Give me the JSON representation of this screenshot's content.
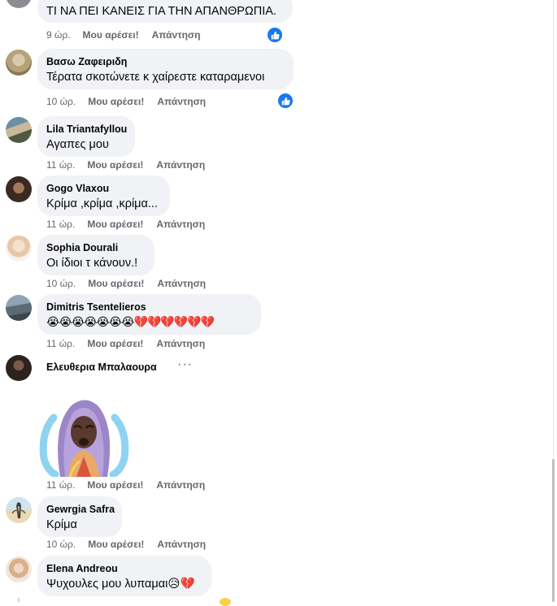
{
  "comments": [
    {
      "name": "",
      "text": "ΤΙ ΝΑ ΠΕΙ ΚΑΝΕΙΣ ΓΙΑ ΤΗΝ ΑΠΑΝΘΡΩΠΙΑ.",
      "time": "9 ώρ.",
      "like_label": "Μου αρέσει!",
      "reply_label": "Απάντηση",
      "reaction_icon": "like-icon"
    },
    {
      "name": "Βασω Ζαφειριδη",
      "text": "Τέρατα σκοτώνετε κ χαίρεστε καταραμενοι",
      "time": "10 ώρ.",
      "like_label": "Μου αρέσει!",
      "reply_label": "Απάντηση",
      "reaction_icon": "like-icon"
    },
    {
      "name": "Lila Triantafyllou",
      "text": "Αγαπες μου",
      "time": "11 ώρ.",
      "like_label": "Μου αρέσει!",
      "reply_label": "Απάντηση"
    },
    {
      "name": "Gogo Vlaxou",
      "text": "Κρίμα ,κρίμα ,κρίμα...",
      "time": "11 ώρ.",
      "like_label": "Μου αρέσει!",
      "reply_label": "Απάντηση"
    },
    {
      "name": "Sophia Dourali",
      "text": "Οι ίδιοι τ κάνουν.!",
      "time": "10 ώρ.",
      "like_label": "Μου αρέσει!",
      "reply_label": "Απάντηση"
    },
    {
      "name": "Dimitris Tsentelieros",
      "text": "😭😭😭😭😭😭😭💔💔💔💔💔💔",
      "time": "11 ώρ.",
      "like_label": "Μου αρέσει!",
      "reply_label": "Απάντηση"
    },
    {
      "name": "Ελευθερια Μπαλαουρα",
      "sticker": "crying-woman-sticker",
      "more": "···",
      "time": "11 ώρ.",
      "like_label": "Μου αρέσει!",
      "reply_label": "Απάντηση"
    },
    {
      "name": "Gewrgia Safra",
      "text": "Κρίμα",
      "time": "10 ώρ.",
      "like_label": "Μου αρέσει!",
      "reply_label": "Απάντηση"
    },
    {
      "name": "Elena Andreou",
      "text": "Ψυχουλες μου λυπαμαι😥💔"
    }
  ],
  "colors": {
    "bubble": "#f0f2f5",
    "meta_text": "#65676b",
    "like_blue": "#1877f2"
  }
}
